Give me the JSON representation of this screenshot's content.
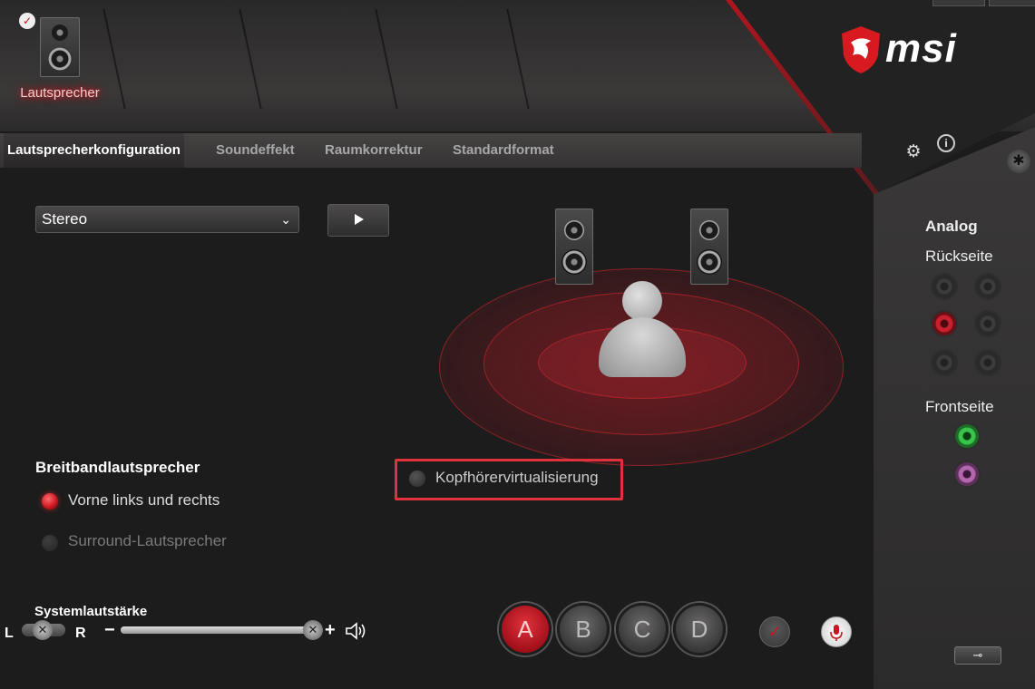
{
  "device": {
    "label": "Lautsprecher"
  },
  "brand": {
    "name": "msi",
    "accent": "#d71920"
  },
  "tabs": [
    {
      "label": "Lautsprecherkonfiguration"
    },
    {
      "label": "Soundeffekt"
    },
    {
      "label": "Raumkorrektur"
    },
    {
      "label": "Standardformat"
    }
  ],
  "config": {
    "selected": "Stereo"
  },
  "panel": {
    "title": "Analog",
    "rear_label": "Rückseite",
    "front_label": "Frontseite"
  },
  "fullrange": {
    "title": "Breitbandlautsprecher",
    "options": [
      {
        "label": "Vorne links und rechts",
        "selected": true
      },
      {
        "label": "Surround-Lautsprecher",
        "selected": false
      }
    ]
  },
  "headphone_virtualization": {
    "label": "Kopfhörervirtualisierung",
    "checked": false
  },
  "volume": {
    "title": "Systemlautstärke",
    "left": "L",
    "right": "R",
    "minus": "−",
    "plus": "+",
    "level": 1.0,
    "balance": 0.5
  },
  "profiles": [
    "A",
    "B",
    "C",
    "D"
  ],
  "active_profile": "A"
}
